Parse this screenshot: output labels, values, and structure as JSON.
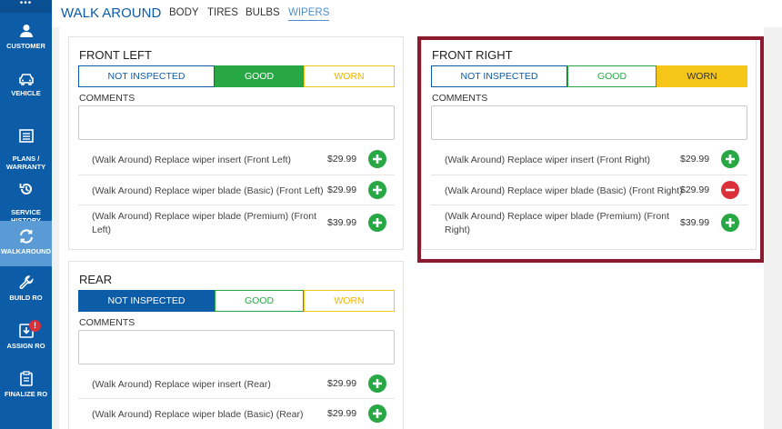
{
  "sidebar": {
    "top_icon": "•••",
    "items": [
      {
        "label": "CUSTOMER",
        "icon": "person-icon"
      },
      {
        "label": "VEHICLE",
        "icon": "car-icon"
      },
      {
        "label": "PLANS /\nWARRANTY",
        "icon": "list-icon"
      },
      {
        "label": "SERVICE\nHISTORY",
        "icon": "history-icon"
      },
      {
        "label": "WALKAROUND",
        "icon": "sync-icon"
      },
      {
        "label": "BUILD RO",
        "icon": "wrench-icon"
      },
      {
        "label": "ASSIGN RO",
        "icon": "download-icon",
        "badge": "!"
      },
      {
        "label": "FINALIZE RO",
        "icon": "clipboard-icon"
      }
    ]
  },
  "header": {
    "title": "WALK AROUND",
    "tabs": [
      "BODY",
      "TIRES",
      "BULBS",
      "WIPERS"
    ],
    "active_tab": "WIPERS"
  },
  "status_options": {
    "not_inspected": "NOT INSPECTED",
    "good": "GOOD",
    "worn": "WORN"
  },
  "comments_label": "COMMENTS",
  "panels": {
    "front_left": {
      "title": "FRONT LEFT",
      "selected": "GOOD",
      "services": [
        {
          "desc": "(Walk Around) Replace wiper insert (Front Left)",
          "price": "$29.99",
          "action": "add"
        },
        {
          "desc": "(Walk Around) Replace wiper blade (Basic) (Front Left)",
          "price": "$29.99",
          "action": "add"
        },
        {
          "desc": "(Walk Around) Replace wiper blade (Premium) (Front\nLeft)",
          "price": "$39.99",
          "action": "add"
        }
      ]
    },
    "front_right": {
      "title": "FRONT RIGHT",
      "selected": "WORN",
      "services": [
        {
          "desc": "(Walk Around) Replace wiper insert (Front Right)",
          "price": "$29.99",
          "action": "add"
        },
        {
          "desc": "(Walk Around) Replace wiper blade (Basic) (Front Right)",
          "price": "$29.99",
          "action": "remove"
        },
        {
          "desc": "(Walk Around) Replace wiper blade (Premium) (Front\nRight)",
          "price": "$39.99",
          "action": "add"
        }
      ]
    },
    "rear": {
      "title": "REAR",
      "selected": "NOT INSPECTED",
      "services": [
        {
          "desc": "(Walk Around) Replace wiper insert (Rear)",
          "price": "$29.99",
          "action": "add"
        },
        {
          "desc": "(Walk Around) Replace wiper blade (Basic) (Rear)",
          "price": "$29.99",
          "action": "add"
        }
      ]
    }
  },
  "colors": {
    "brand_blue": "#0d5ca8",
    "good_green": "#28a745",
    "worn_yellow": "#f5c518",
    "remove_red": "#d9303a",
    "highlight": "#8b1a2e"
  }
}
